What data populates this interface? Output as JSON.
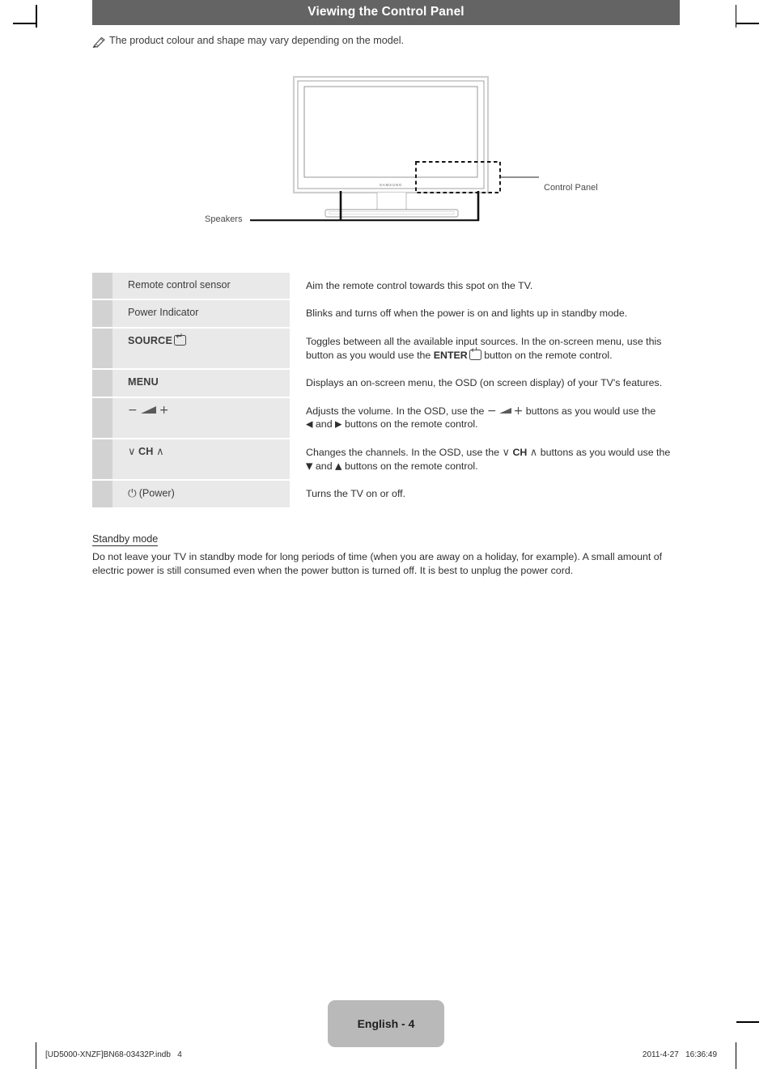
{
  "document": {
    "section_title": "Viewing the Control Panel",
    "note": {
      "icon": "note-pencil-icon",
      "text": "The product colour and shape may vary depending on the model."
    }
  },
  "figure": {
    "name": "tv-front-diagram",
    "brand_mark": "SAMSUNG",
    "callouts": {
      "control_panel": "Control Panel",
      "speakers": "Speakers"
    }
  },
  "spec_table": {
    "rows": [
      {
        "label": "Remote control sensor",
        "label_style": "normal",
        "icons": [],
        "description": "Aim the remote control towards this spot on the TV."
      },
      {
        "label": "Power Indicator",
        "label_style": "normal",
        "icons": [],
        "description": "Blinks and turns off when the power is on and lights up in standby mode."
      },
      {
        "label": "SOURCE",
        "label_style": "bold",
        "icons": [
          "enter-icon"
        ],
        "description_part1": "Toggles between all the available input sources. In the on-screen menu, use this button as you would use the ",
        "description_strong": "ENTER",
        "description_part2": " button on the remote control."
      },
      {
        "label": "MENU",
        "label_style": "bold",
        "icons": [],
        "description": "Displays an on-screen menu, the OSD (on screen display) of your TV's features."
      },
      {
        "label": "",
        "label_style": "icons",
        "icons": [
          "minus-icon",
          "volume-wedge-icon",
          "plus-icon"
        ],
        "label_minus": "−",
        "label_plus": "+",
        "description_part1": "Adjusts the volume. In the OSD, use the ",
        "description_minus": "−",
        "description_plus": "+",
        "description_part2": " buttons as you would use the ",
        "description_left_arrow": "◀",
        "description_and": " and ",
        "description_right_arrow": "▶",
        "description_part3": " buttons on the remote control."
      },
      {
        "label": "CH",
        "label_style": "bold",
        "icons": [
          "chevron-down-icon",
          "chevron-up-icon"
        ],
        "label_chev_down": "∨",
        "label_chev_up": "∧",
        "description_part1": "Changes the channels. In the OSD, use the ",
        "description_chev_down": "∨",
        "description_ch": "CH",
        "description_chev_up": "∧",
        "description_part2": " buttons as you would use the ",
        "description_down_arrow": "▼",
        "description_and": " and ",
        "description_up_arrow": "▲",
        "description_part3": " buttons on the remote control."
      },
      {
        "label": "(Power)",
        "label_style": "normal",
        "icons": [
          "power-icon"
        ],
        "label_power_glyph": "⏻",
        "description": "Turns the TV on or off."
      }
    ]
  },
  "standby": {
    "heading": "Standby mode",
    "body": "Do not leave your TV in standby mode for long periods of time (when you are away on a holiday, for example). A small amount of electric power is still consumed even when the power button is turned off. It is best to unplug the power cord."
  },
  "footer": {
    "page_badge": "English - 4",
    "file_reference": "[UD5000-XNZF]BN68-03432P.indb   4",
    "timestamp": "2011-4-27   16:36:49"
  },
  "colors": {
    "title_bar": "#646464",
    "row_mark": "#d2d2d2",
    "row_label": "#e9e9e9",
    "badge": "#b9b9b9"
  }
}
